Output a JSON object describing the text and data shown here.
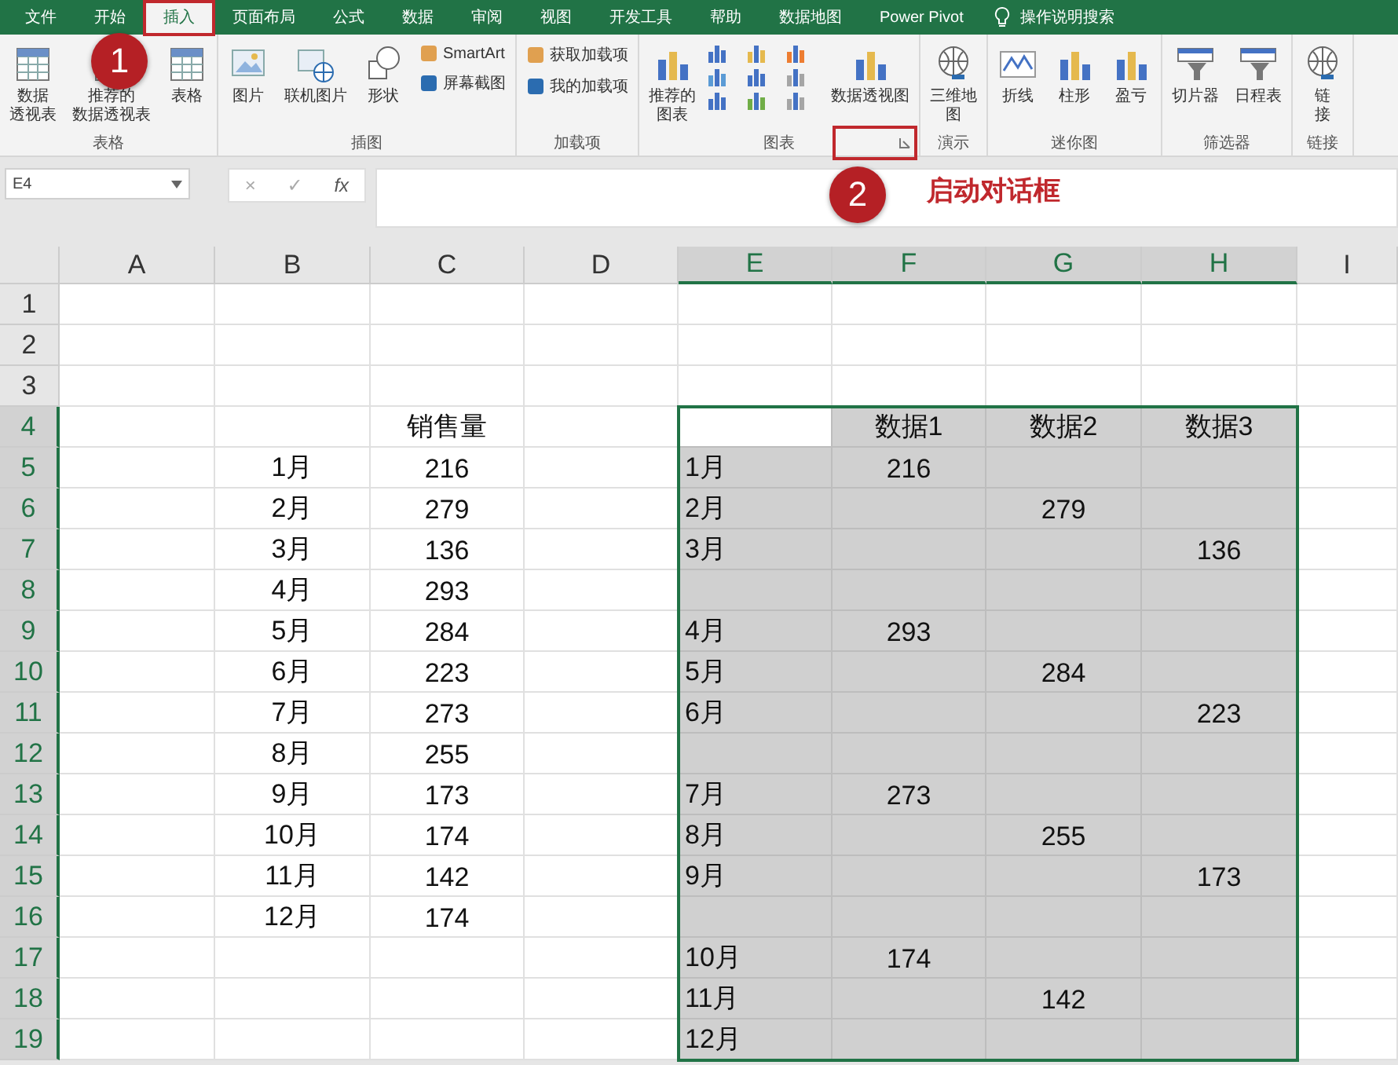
{
  "menu_tabs": [
    {
      "label": "文件",
      "selected": false
    },
    {
      "label": "开始",
      "selected": false
    },
    {
      "label": "插入",
      "selected": true
    },
    {
      "label": "页面布局",
      "selected": false
    },
    {
      "label": "公式",
      "selected": false
    },
    {
      "label": "数据",
      "selected": false
    },
    {
      "label": "审阅",
      "selected": false
    },
    {
      "label": "视图",
      "selected": false
    },
    {
      "label": "开发工具",
      "selected": false
    },
    {
      "label": "帮助",
      "selected": false
    },
    {
      "label": "数据地图",
      "selected": false
    },
    {
      "label": "Power Pivot",
      "selected": false
    }
  ],
  "tell_me": "操作说明搜索",
  "ribbon_groups": [
    {
      "label": "表格",
      "launcher": false,
      "items": [
        {
          "kind": "large",
          "lines": [
            "数据",
            "透视表"
          ]
        },
        {
          "kind": "large",
          "lines": [
            "推荐的",
            "数据透视表"
          ]
        },
        {
          "kind": "large",
          "lines": [
            "表格"
          ]
        }
      ]
    },
    {
      "label": "插图",
      "launcher": false,
      "items": [
        {
          "kind": "large",
          "lines": [
            "图片"
          ]
        },
        {
          "kind": "large",
          "lines": [
            "联机图片"
          ]
        },
        {
          "kind": "large",
          "lines": [
            "形状"
          ]
        },
        {
          "kind": "stack",
          "children": [
            {
              "label": "SmartArt"
            },
            {
              "label": "屏幕截图"
            }
          ]
        }
      ]
    },
    {
      "label": "加载项",
      "launcher": false,
      "items": [
        {
          "kind": "stack",
          "children": [
            {
              "label": "获取加载项"
            },
            {
              "label": "我的加载项"
            }
          ]
        }
      ]
    },
    {
      "label": "图表",
      "launcher": true,
      "items": [
        {
          "kind": "large",
          "lines": [
            "推荐的",
            "图表"
          ]
        },
        {
          "kind": "gallery"
        },
        {
          "kind": "large",
          "lines": [
            "数据透视图"
          ]
        }
      ]
    },
    {
      "label": "演示",
      "launcher": false,
      "items": [
        {
          "kind": "large",
          "lines": [
            "三维地",
            "图"
          ]
        }
      ]
    },
    {
      "label": "迷你图",
      "launcher": false,
      "items": [
        {
          "kind": "large",
          "lines": [
            "折线"
          ]
        },
        {
          "kind": "large",
          "lines": [
            "柱形"
          ]
        },
        {
          "kind": "large",
          "lines": [
            "盈亏"
          ]
        }
      ]
    },
    {
      "label": "筛选器",
      "launcher": false,
      "items": [
        {
          "kind": "large",
          "lines": [
            "切片器"
          ]
        },
        {
          "kind": "large",
          "lines": [
            "日程表"
          ]
        }
      ]
    },
    {
      "label": "链接",
      "launcher": false,
      "items": [
        {
          "kind": "large",
          "lines": [
            "链",
            "接"
          ]
        }
      ]
    }
  ],
  "formula_bar": {
    "name_box": "E4",
    "cancel": "×",
    "enter": "✓",
    "function": "fx"
  },
  "sheet": {
    "columns": [
      {
        "label": "A",
        "selected": false
      },
      {
        "label": "B",
        "selected": false
      },
      {
        "label": "C",
        "selected": false
      },
      {
        "label": "D",
        "selected": false
      },
      {
        "label": "E",
        "selected": true
      },
      {
        "label": "F",
        "selected": true
      },
      {
        "label": "G",
        "selected": true
      },
      {
        "label": "H",
        "selected": true
      },
      {
        "label": "I",
        "selected": false
      }
    ],
    "rows": [
      {
        "number": "1",
        "selected": false,
        "cells": [
          "",
          "",
          "",
          "",
          "",
          "",
          "",
          "",
          ""
        ]
      },
      {
        "number": "2",
        "selected": false,
        "cells": [
          "",
          "",
          "",
          "",
          "",
          "",
          "",
          "",
          ""
        ]
      },
      {
        "number": "3",
        "selected": false,
        "cells": [
          "",
          "",
          "",
          "",
          "",
          "",
          "",
          "",
          ""
        ]
      },
      {
        "number": "4",
        "selected": true,
        "cells": [
          "",
          "",
          "销售量",
          "",
          "",
          "数据1",
          "数据2",
          "数据3",
          ""
        ]
      },
      {
        "number": "5",
        "selected": true,
        "cells": [
          "",
          "1月",
          "216",
          "",
          "1月",
          "216",
          "",
          "",
          ""
        ]
      },
      {
        "number": "6",
        "selected": true,
        "cells": [
          "",
          "2月",
          "279",
          "",
          "2月",
          "",
          "279",
          "",
          ""
        ]
      },
      {
        "number": "7",
        "selected": true,
        "cells": [
          "",
          "3月",
          "136",
          "",
          "3月",
          "",
          "",
          "136",
          ""
        ]
      },
      {
        "number": "8",
        "selected": true,
        "cells": [
          "",
          "4月",
          "293",
          "",
          "",
          "",
          "",
          "",
          ""
        ]
      },
      {
        "number": "9",
        "selected": true,
        "cells": [
          "",
          "5月",
          "284",
          "",
          "4月",
          "293",
          "",
          "",
          ""
        ]
      },
      {
        "number": "10",
        "selected": true,
        "cells": [
          "",
          "6月",
          "223",
          "",
          "5月",
          "",
          "284",
          "",
          ""
        ]
      },
      {
        "number": "11",
        "selected": true,
        "cells": [
          "",
          "7月",
          "273",
          "",
          "6月",
          "",
          "",
          "223",
          ""
        ]
      },
      {
        "number": "12",
        "selected": true,
        "cells": [
          "",
          "8月",
          "255",
          "",
          "",
          "",
          "",
          "",
          ""
        ]
      },
      {
        "number": "13",
        "selected": true,
        "cells": [
          "",
          "9月",
          "173",
          "",
          "7月",
          "273",
          "",
          "",
          ""
        ]
      },
      {
        "number": "14",
        "selected": true,
        "cells": [
          "",
          "10月",
          "174",
          "",
          "8月",
          "",
          "255",
          "",
          ""
        ]
      },
      {
        "number": "15",
        "selected": true,
        "cells": [
          "",
          "11月",
          "142",
          "",
          "9月",
          "",
          "",
          "173",
          ""
        ]
      },
      {
        "number": "16",
        "selected": true,
        "cells": [
          "",
          "12月",
          "174",
          "",
          "",
          "",
          "",
          "",
          ""
        ]
      },
      {
        "number": "17",
        "selected": true,
        "cells": [
          "",
          "",
          "",
          "",
          "10月",
          "174",
          "",
          "",
          ""
        ]
      },
      {
        "number": "18",
        "selected": true,
        "cells": [
          "",
          "",
          "",
          "",
          "11月",
          "",
          "142",
          "",
          ""
        ]
      },
      {
        "number": "19",
        "selected": true,
        "cells": [
          "",
          "",
          "",
          "",
          "12月",
          "",
          "",
          "",
          ""
        ]
      }
    ]
  },
  "annotations": [
    {
      "kind": "frame"
    },
    {
      "kind": "badge",
      "text": "1"
    },
    {
      "kind": "frame"
    },
    {
      "kind": "badge",
      "text": "2"
    },
    {
      "kind": "label",
      "text": "启动对话框"
    }
  ]
}
